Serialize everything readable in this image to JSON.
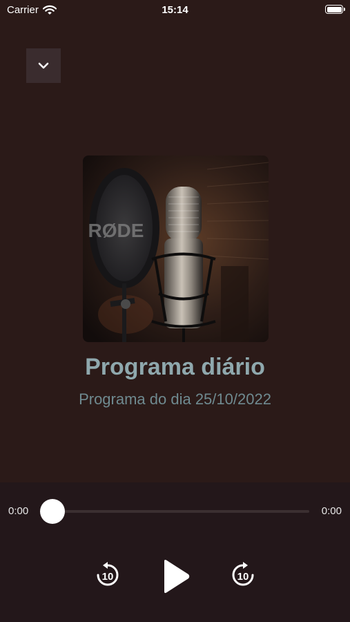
{
  "status_bar": {
    "carrier": "Carrier",
    "time": "15:14",
    "battery_level": 1.0
  },
  "episode": {
    "title": "Programa diário",
    "subtitle": "Programa do dia 25/10/2022",
    "cover_text": "RØDE"
  },
  "player": {
    "current_time": "0:00",
    "duration": "0:00",
    "progress": 0,
    "skip_back_label": "10",
    "skip_forward_label": "10"
  },
  "icons": {
    "collapse": "chevron-down-icon",
    "rewind": "rewind-10-icon",
    "play": "play-icon",
    "forward": "forward-10-icon",
    "wifi": "wifi-icon",
    "battery": "battery-icon"
  },
  "colors": {
    "background": "#2b1a18",
    "player_background": "#23171a",
    "title": "#8fa8ad",
    "subtitle": "#6f8a90",
    "button_background": "#3a2c2e"
  }
}
